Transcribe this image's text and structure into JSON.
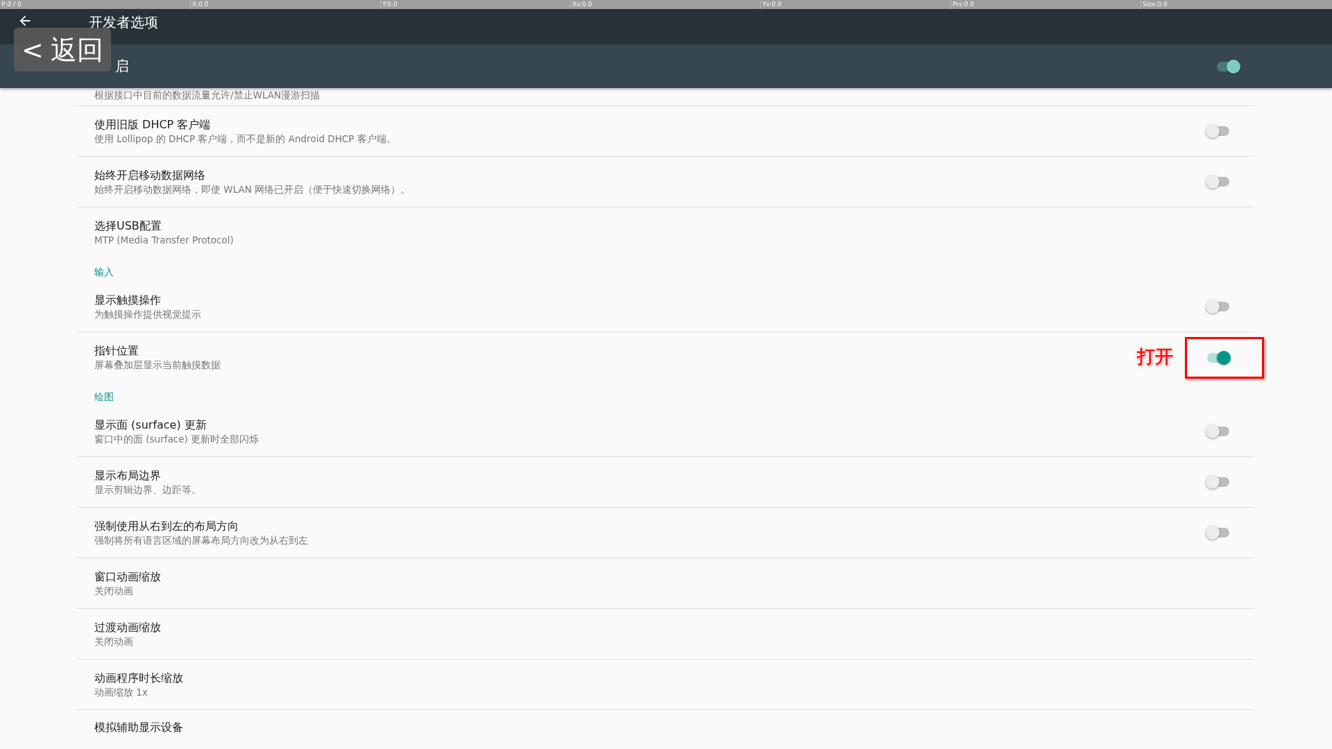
{
  "pointer_bar": [
    "P:0 / 0",
    "X:0.0",
    "Y:0.0",
    "Xv:0.0",
    "Yv:0.0",
    "Prs:0.0",
    "Size:0.0"
  ],
  "toolbar": {
    "title": "开发者选项"
  },
  "master_switch": {
    "label": "启",
    "on": true
  },
  "back_overlay": {
    "caret": "<",
    "label": "返回"
  },
  "items": [
    {
      "kind": "partial",
      "subtitle": "根据接口中目前的数据流量允许/禁止WLAN漫游扫描"
    },
    {
      "kind": "switch",
      "title": "使用旧版 DHCP 客户端",
      "subtitle": "使用 Lollipop 的 DHCP 客户端，而不是新的 Android DHCP 客户端。",
      "on": false
    },
    {
      "kind": "switch",
      "title": "始终开启移动数据网络",
      "subtitle": "始终开启移动数据网络，即使 WLAN 网络已开启（便于快速切换网络）。",
      "on": false
    },
    {
      "kind": "value",
      "title": "选择USB配置",
      "subtitle": "MTP (Media Transfer Protocol)"
    },
    {
      "kind": "category",
      "title": "输入"
    },
    {
      "kind": "switch",
      "title": "显示触摸操作",
      "subtitle": "为触摸操作提供视觉提示",
      "on": false
    },
    {
      "kind": "switch",
      "title": "指针位置",
      "subtitle": "屏幕叠加层显示当前触摸数据",
      "on": true,
      "callout": "打开"
    },
    {
      "kind": "category",
      "title": "绘图"
    },
    {
      "kind": "switch",
      "title": "显示面 (surface) 更新",
      "subtitle": "窗口中的面 (surface) 更新时全部闪烁",
      "on": false
    },
    {
      "kind": "switch",
      "title": "显示布局边界",
      "subtitle": "显示剪辑边界、边距等。",
      "on": false
    },
    {
      "kind": "switch",
      "title": "强制使用从右到左的布局方向",
      "subtitle": "强制将所有语言区域的屏幕布局方向改为从右到左",
      "on": false
    },
    {
      "kind": "value",
      "title": "窗口动画缩放",
      "subtitle": "关闭动画"
    },
    {
      "kind": "value",
      "title": "过渡动画缩放",
      "subtitle": "关闭动画"
    },
    {
      "kind": "value",
      "title": "动画程序时长缩放",
      "subtitle": "动画缩放 1x"
    },
    {
      "kind": "value",
      "title": "模拟辅助显示设备"
    }
  ]
}
